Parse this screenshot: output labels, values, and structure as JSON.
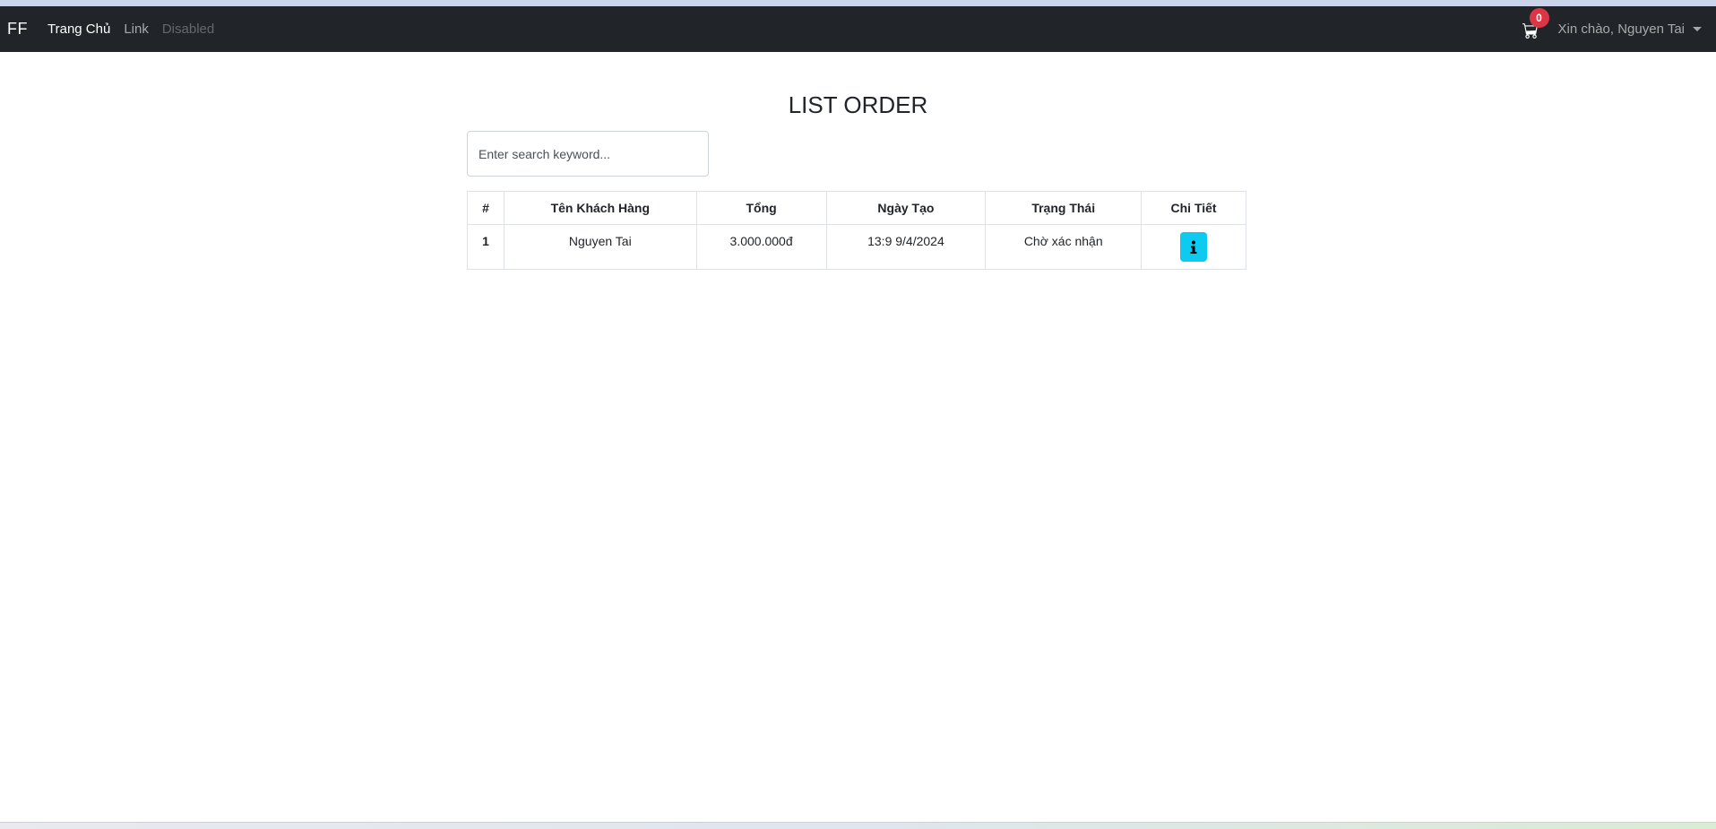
{
  "navbar": {
    "brand": "FF",
    "links": [
      {
        "label": "Trang Chủ",
        "state": "active"
      },
      {
        "label": "Link",
        "state": "normal"
      },
      {
        "label": "Disabled",
        "state": "disabled"
      }
    ],
    "cart_count": "0",
    "user_greeting": "Xin chào, Nguyen Tai"
  },
  "page": {
    "title": "LIST ORDER"
  },
  "search": {
    "placeholder": "Enter search keyword..."
  },
  "table": {
    "headers": [
      "#",
      "Tên Khách Hàng",
      "Tổng",
      "Ngày Tạo",
      "Trạng Thái",
      "Chi Tiết"
    ],
    "rows": [
      {
        "index": "1",
        "customer": "Nguyen Tai",
        "total": "3.000.000đ",
        "created": "13:9 9/4/2024",
        "status": "Chờ xác nhận",
        "detail_icon": "info-icon"
      }
    ]
  },
  "colors": {
    "navbar_bg": "#212529",
    "badge": "#dc3545",
    "info_button": "#0dcaf0"
  }
}
